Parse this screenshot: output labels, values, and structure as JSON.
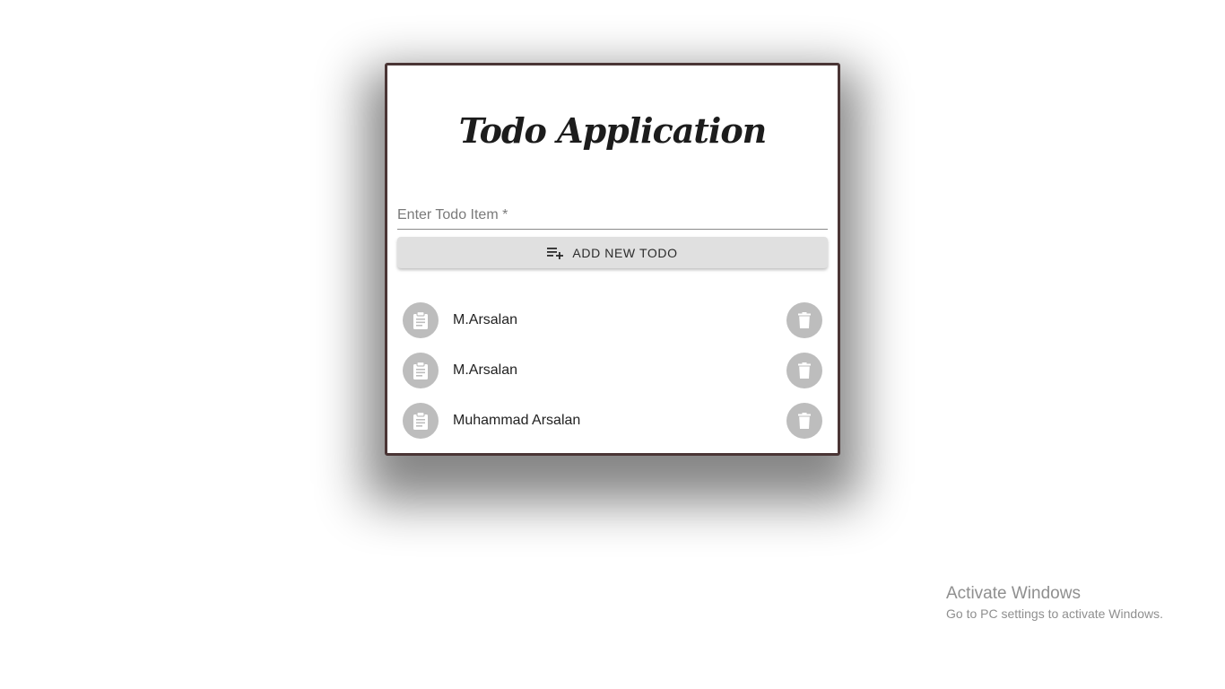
{
  "app": {
    "title": "Todo Application"
  },
  "input": {
    "placeholder": "Enter Todo Item *",
    "value": ""
  },
  "add_button": {
    "label": "ADD NEW TODO",
    "icon": "playlist-add-icon"
  },
  "todos": [
    {
      "text": "M.Arsalan",
      "icon": "assignment-icon",
      "action_icon": "delete-icon"
    },
    {
      "text": "M.Arsalan",
      "icon": "assignment-icon",
      "action_icon": "delete-icon"
    },
    {
      "text": "Muhammad Arsalan",
      "icon": "assignment-icon",
      "action_icon": "delete-icon"
    }
  ],
  "watermark": {
    "title": "Activate Windows",
    "subtitle": "Go to PC settings to activate Windows."
  },
  "colors": {
    "card_border": "#4a3535",
    "button_bg": "#e0e0e0",
    "avatar_bg": "#bdbdbd",
    "icon_fill": "#ffffff"
  }
}
